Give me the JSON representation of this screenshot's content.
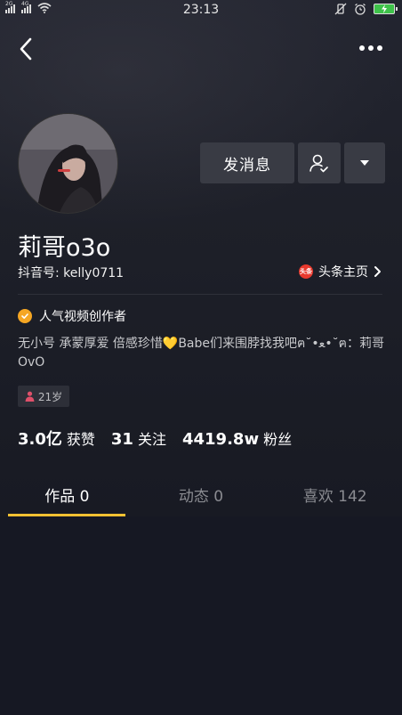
{
  "status_bar": {
    "left_label_1": "2G",
    "left_label_2": "4G",
    "time": "23:13"
  },
  "profile": {
    "nickname": "莉哥o3o",
    "douyin_id": "抖音号: kelly0711",
    "toutiao_badge": "头条",
    "toutiao_link": "头条主页",
    "creator_badge": "人气视频创作者",
    "bio": "无小号 承蒙厚爱 倍感珍惜💛Babe们来围脖找我吧ฅ˘•ﻌ•˘ฅ：莉哥OvO",
    "age": "21岁"
  },
  "actions": {
    "message_label": "发消息"
  },
  "stats": [
    {
      "num": "3.0亿",
      "label": "获赞"
    },
    {
      "num": "31",
      "label": "关注"
    },
    {
      "num": "4419.8w",
      "label": "粉丝"
    }
  ],
  "tabs": [
    {
      "label": "作品 0"
    },
    {
      "label": "动态 0"
    },
    {
      "label": "喜欢 142"
    }
  ],
  "colors": {
    "accent": "#f5c132",
    "background": "#161823",
    "toutiao_red": "#e8392d",
    "creator_orange": "#f5a623"
  }
}
